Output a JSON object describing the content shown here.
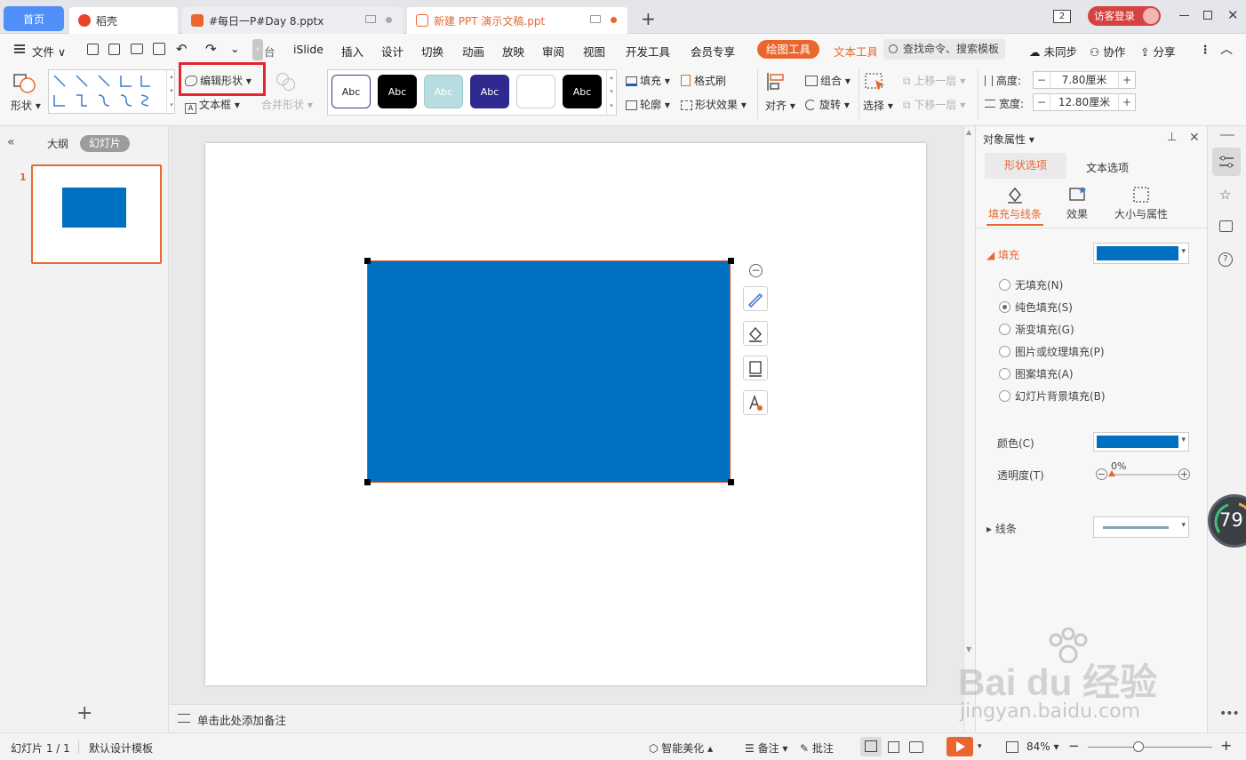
{
  "tabs": {
    "home": "首页",
    "daoke": "稻壳",
    "doc1": "#每日一P#Day 8.pptx",
    "doc2": "新建 PPT 演示文稿.ppt",
    "badge": "2",
    "login": "访客登录"
  },
  "menu": {
    "file": "文件",
    "items": [
      "iSlide",
      "插入",
      "设计",
      "切换",
      "动画",
      "放映",
      "审阅",
      "视图",
      "开发工具",
      "会员专享"
    ],
    "drawing_tools": "绘图工具",
    "text_tools": "文本工具",
    "search": "查找命令、搜索模板",
    "sync": "未同步",
    "collab": "协作",
    "share": "分享"
  },
  "ribbon": {
    "shape": "形状",
    "edit_shape": "编辑形状",
    "text_box": "文本框",
    "merge_shape": "合并形状",
    "style_label": "Abc",
    "fill": "填充",
    "format_painter": "格式刷",
    "outline": "轮廓",
    "shape_effect": "形状效果",
    "align": "对齐",
    "group": "组合",
    "rotate": "旋转",
    "select": "选择",
    "bring_forward": "上移一层",
    "send_backward": "下移一层",
    "height_label": "高度:",
    "height_value": "7.80厘米",
    "width_label": "宽度:",
    "width_value": "12.80厘米"
  },
  "left_panel": {
    "outline_tab": "大纲",
    "slides_tab": "幻灯片",
    "slide_number": "1"
  },
  "notes": {
    "placeholder": "单击此处添加备注"
  },
  "right_panel": {
    "title": "对象属性",
    "tab_shape": "形状选项",
    "tab_text": "文本选项",
    "sub_fill_line": "填充与线条",
    "sub_effect": "效果",
    "sub_size": "大小与属性",
    "fill_section": "填充",
    "options": [
      "无填充(N)",
      "纯色填充(S)",
      "渐变填充(G)",
      "图片或纹理填充(P)",
      "图案填充(A)",
      "幻灯片背景填充(B)"
    ],
    "selected_option": 1,
    "color_label": "颜色(C)",
    "transparency_label": "透明度(T)",
    "transparency_value": "0%",
    "line_section": "线条"
  },
  "sidebar": {
    "progress": "79"
  },
  "status": {
    "slide_info": "幻灯片 1 / 1",
    "template": "默认设计模板",
    "beautify": "智能美化",
    "notes": "备注",
    "comments": "批注",
    "zoom": "84%"
  },
  "watermark": {
    "brand": "Bai du 经验",
    "url": "jingyan.baidu.com"
  },
  "colors": {
    "shape_fill": "#0070c0",
    "accent_orange": "#e9672f",
    "highlight_red": "#e8232e"
  }
}
